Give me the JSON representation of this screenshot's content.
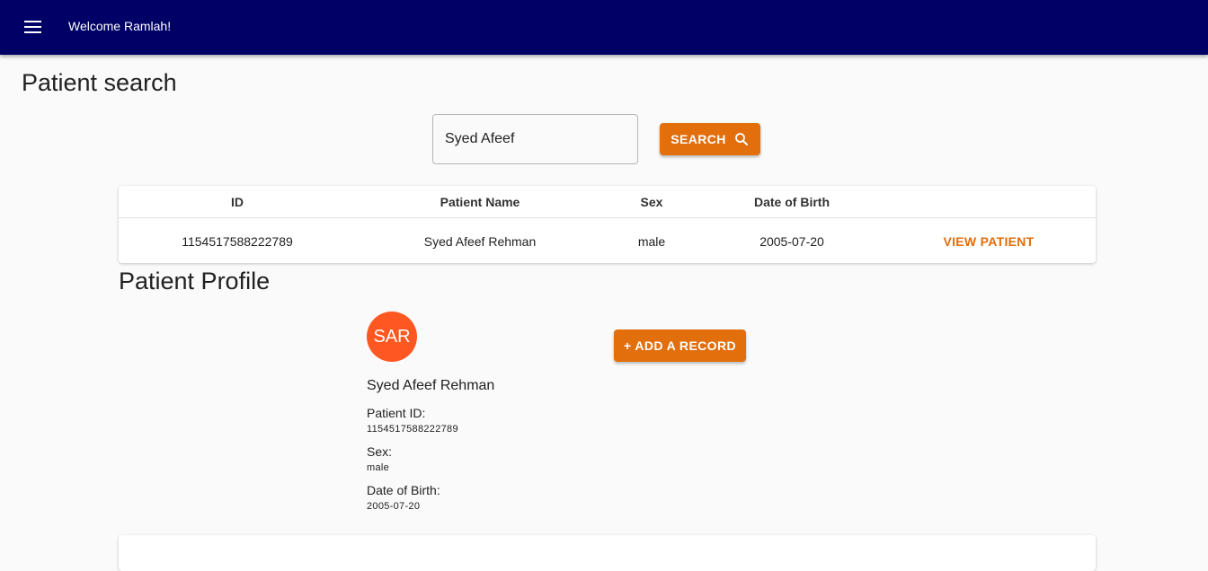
{
  "appbar": {
    "title": "Welcome Ramlah!",
    "menu_icon": "menu-icon"
  },
  "search": {
    "title": "Patient search",
    "input_value": "Syed Afeef",
    "button_label": "SEARCH",
    "button_icon": "search-icon",
    "accent_color": "#e26e0c"
  },
  "results": {
    "columns": [
      "ID",
      "Patient Name",
      "Sex",
      "Date of Birth"
    ],
    "rows": [
      {
        "id": "1154517588222789",
        "name": "Syed Afeef Rehman",
        "sex": "male",
        "dob": "2005-07-20",
        "action": "VIEW PATIENT"
      }
    ]
  },
  "profile": {
    "title": "Patient Profile",
    "initials": "SAR",
    "avatar_color": "#ff5722",
    "name": "Syed Afeef Rehman",
    "add_record_label": "+ ADD A RECORD",
    "fields": [
      {
        "label": "Patient ID:",
        "value": "1154517588222789"
      },
      {
        "label": "Sex:",
        "value": "male"
      },
      {
        "label": "Date of Birth:",
        "value": "2005-07-20"
      }
    ]
  }
}
